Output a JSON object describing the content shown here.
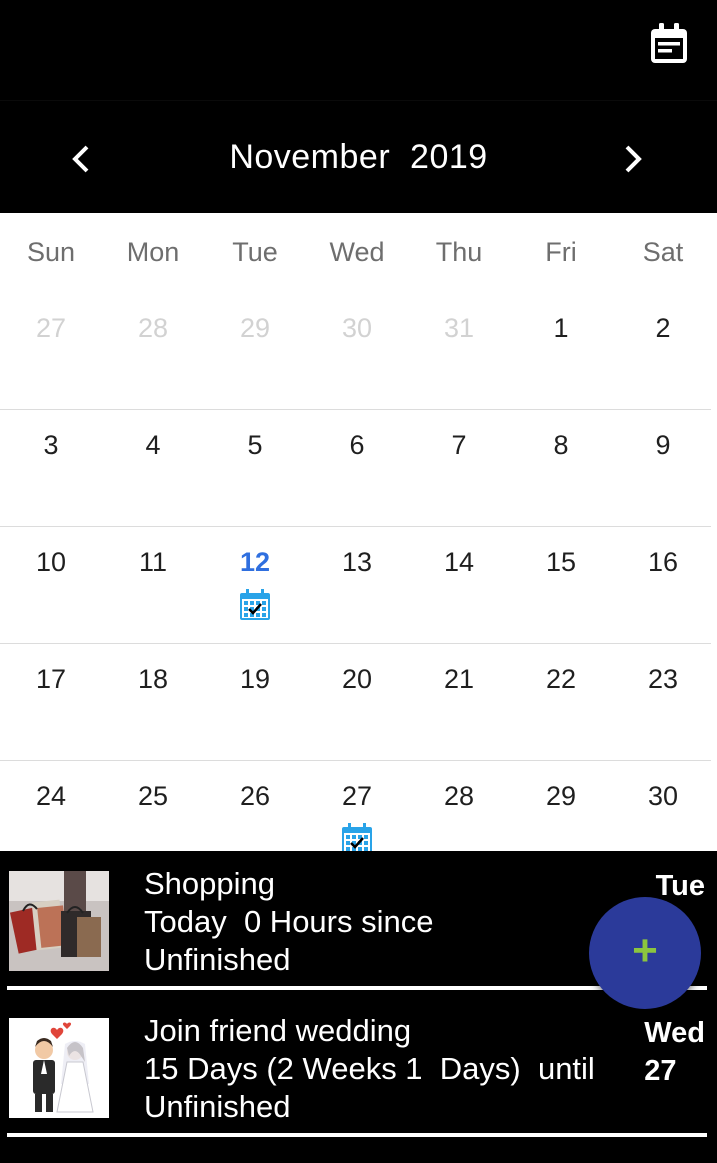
{
  "header": {
    "icon": "calendar-view-icon",
    "month_title": "November  2019",
    "prev_icon": "chevron-left-icon",
    "next_icon": "chevron-right-icon"
  },
  "calendar": {
    "weekdays": [
      "Sun",
      "Mon",
      "Tue",
      "Wed",
      "Thu",
      "Fri",
      "Sat"
    ],
    "weeks": [
      [
        {
          "d": "27",
          "other": true
        },
        {
          "d": "28",
          "other": true
        },
        {
          "d": "29",
          "other": true
        },
        {
          "d": "30",
          "other": true
        },
        {
          "d": "31",
          "other": true
        },
        {
          "d": "1"
        },
        {
          "d": "2"
        }
      ],
      [
        {
          "d": "3"
        },
        {
          "d": "4"
        },
        {
          "d": "5"
        },
        {
          "d": "6"
        },
        {
          "d": "7"
        },
        {
          "d": "8"
        },
        {
          "d": "9"
        }
      ],
      [
        {
          "d": "10"
        },
        {
          "d": "11"
        },
        {
          "d": "12",
          "today": true,
          "event": true
        },
        {
          "d": "13"
        },
        {
          "d": "14"
        },
        {
          "d": "15"
        },
        {
          "d": "16"
        }
      ],
      [
        {
          "d": "17"
        },
        {
          "d": "18"
        },
        {
          "d": "19"
        },
        {
          "d": "20"
        },
        {
          "d": "21"
        },
        {
          "d": "22"
        },
        {
          "d": "23"
        }
      ],
      [
        {
          "d": "24"
        },
        {
          "d": "25"
        },
        {
          "d": "26"
        },
        {
          "d": "27",
          "event": true
        },
        {
          "d": "28"
        },
        {
          "d": "29"
        },
        {
          "d": "30"
        }
      ]
    ],
    "today_color": "#2f6fdf",
    "event_icon": "calendar-check-icon",
    "event_icon_color": "#29a3e8"
  },
  "events": [
    {
      "title": "Shopping",
      "detail": "Today  0 Hours since",
      "status": "Unfinished",
      "day": "Tue",
      "date": "",
      "thumb": "shopping-bags-image"
    },
    {
      "title": "Join friend wedding",
      "detail": "15 Days (2 Weeks 1  Days)  until",
      "status": "Unfinished",
      "day": "Wed",
      "date": "27",
      "thumb": "wedding-couple-image"
    }
  ],
  "fab": {
    "label": "+",
    "icon": "add-icon",
    "color": "#2b3a9a",
    "plus_color": "#8bc53f"
  }
}
